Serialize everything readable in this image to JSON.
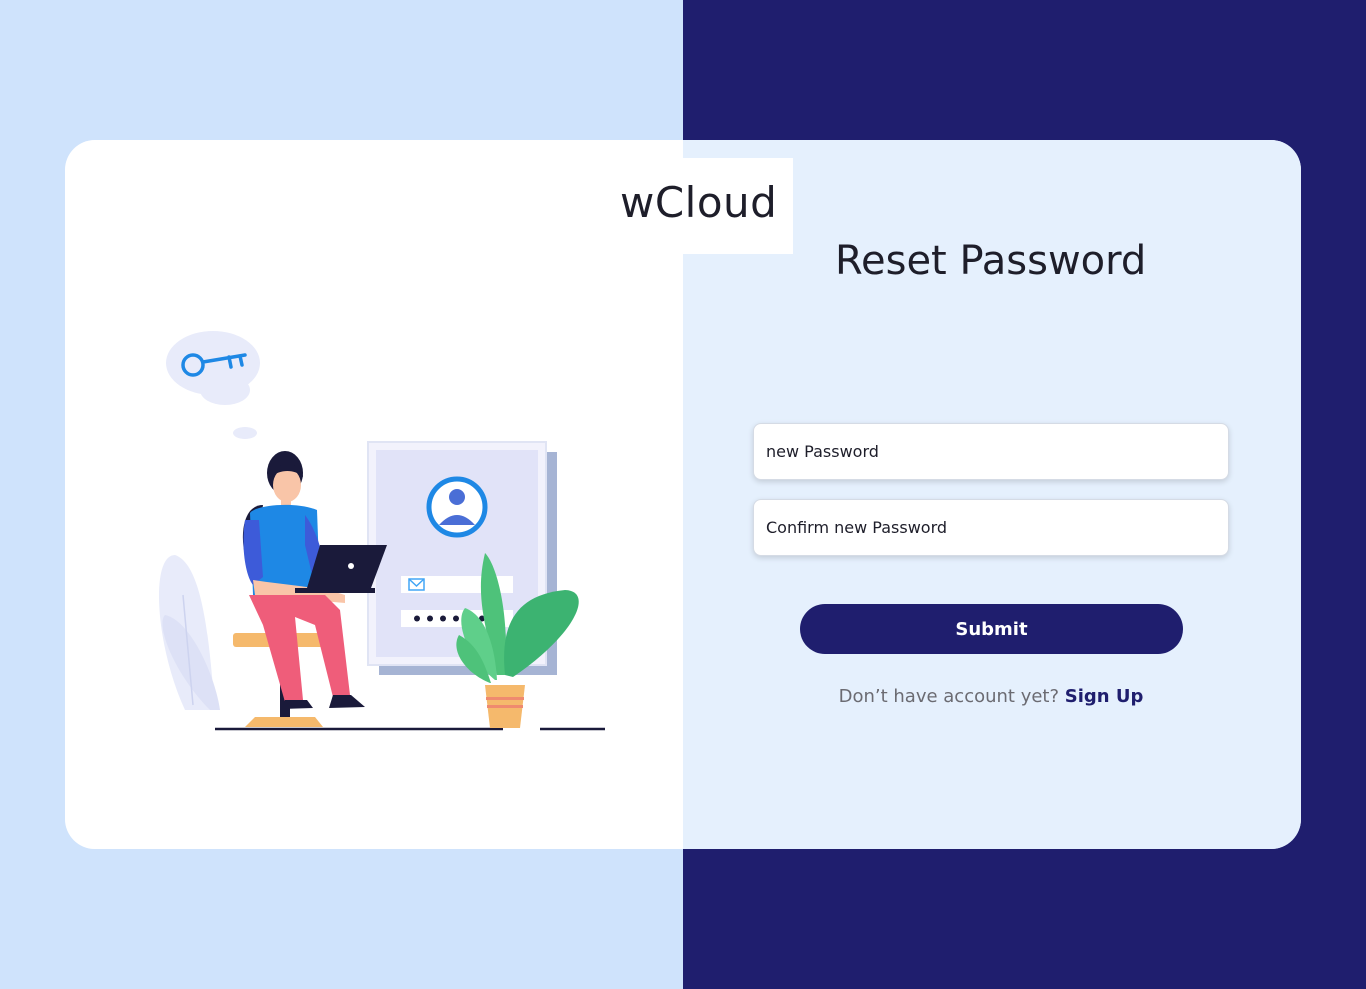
{
  "brand": {
    "name": "wCloud"
  },
  "form": {
    "title": "Reset Password",
    "new_password_placeholder": "new Password",
    "confirm_password_placeholder": "Confirm new Password",
    "submit_label": "Submit",
    "signup_prompt": "Don’t have account yet?",
    "signup_link": "Sign Up"
  },
  "colors": {
    "left_background": "#cfe3fc",
    "right_background": "#1f1e6e",
    "card_right": "#e5f0fd",
    "accent": "#1f1e6e"
  }
}
